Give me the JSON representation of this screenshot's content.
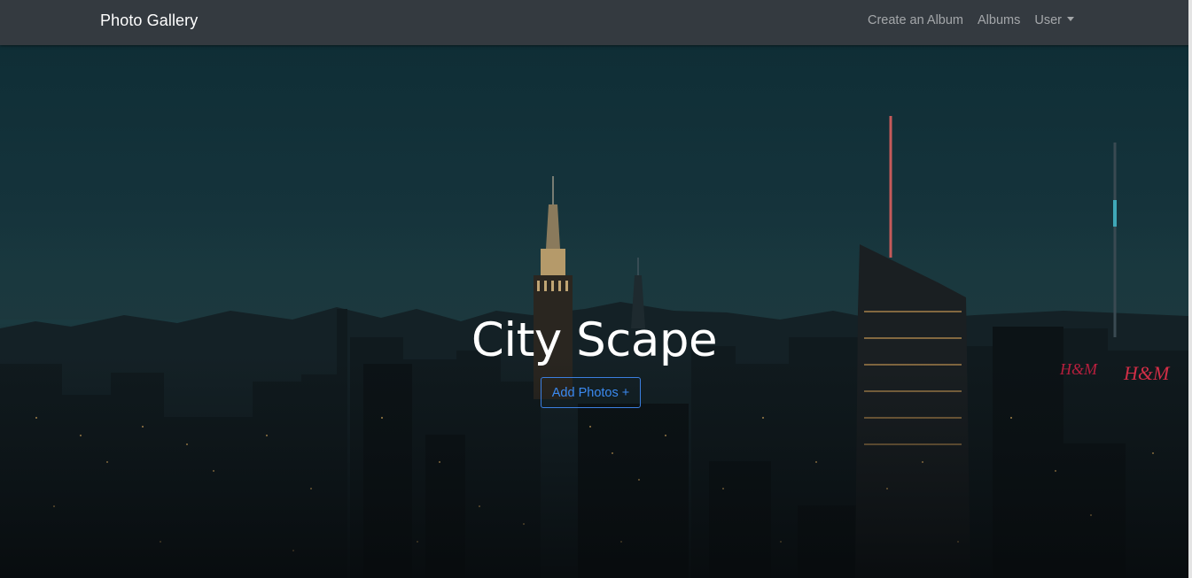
{
  "navbar": {
    "brand": "Photo Gallery",
    "links": [
      {
        "label": "Create an Album"
      },
      {
        "label": "Albums"
      },
      {
        "label": "User"
      }
    ]
  },
  "hero": {
    "title": "City Scape",
    "button_label": "Add Photos +"
  },
  "colors": {
    "navbar_bg": "#343a40",
    "button_accent": "#3b7fe0"
  }
}
